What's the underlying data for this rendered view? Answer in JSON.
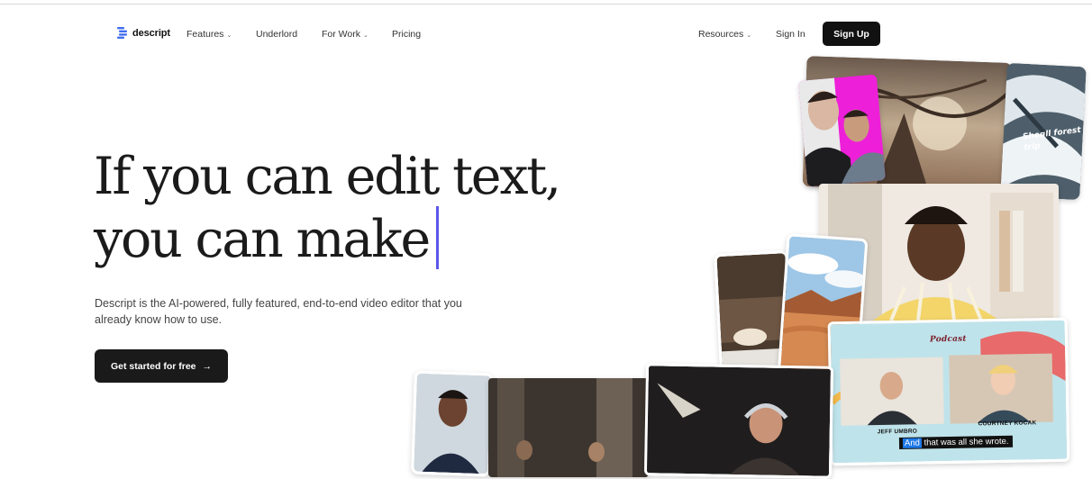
{
  "nav": {
    "logo_text": "descript",
    "features": "Features",
    "underlord": "Underlord",
    "for_work": "For Work",
    "pricing": "Pricing",
    "resources": "Resources",
    "sign_in": "Sign In",
    "sign_up": "Sign Up"
  },
  "hero": {
    "headline_line1": "If you can edit text,",
    "headline_line2": "you can make",
    "subtext": "Descript is the AI-powered, fully featured, end-to-end video editor that you already know how to use.",
    "cta_label": "Get started for free",
    "cta_arrow": "→"
  },
  "collage": {
    "snow_caption": "Sheɑll forest trip",
    "podcast_logo": "Podcast",
    "speaker_left": "JEFF UMBRO",
    "speaker_right": "COURTNEY KOCAK",
    "subtitle_highlight": "And",
    "subtitle_rest": " that was all she wrote."
  },
  "colors": {
    "accent_caret": "#5b57ea",
    "button_dark": "#111111",
    "subtitle_highlight": "#1e79e8"
  }
}
